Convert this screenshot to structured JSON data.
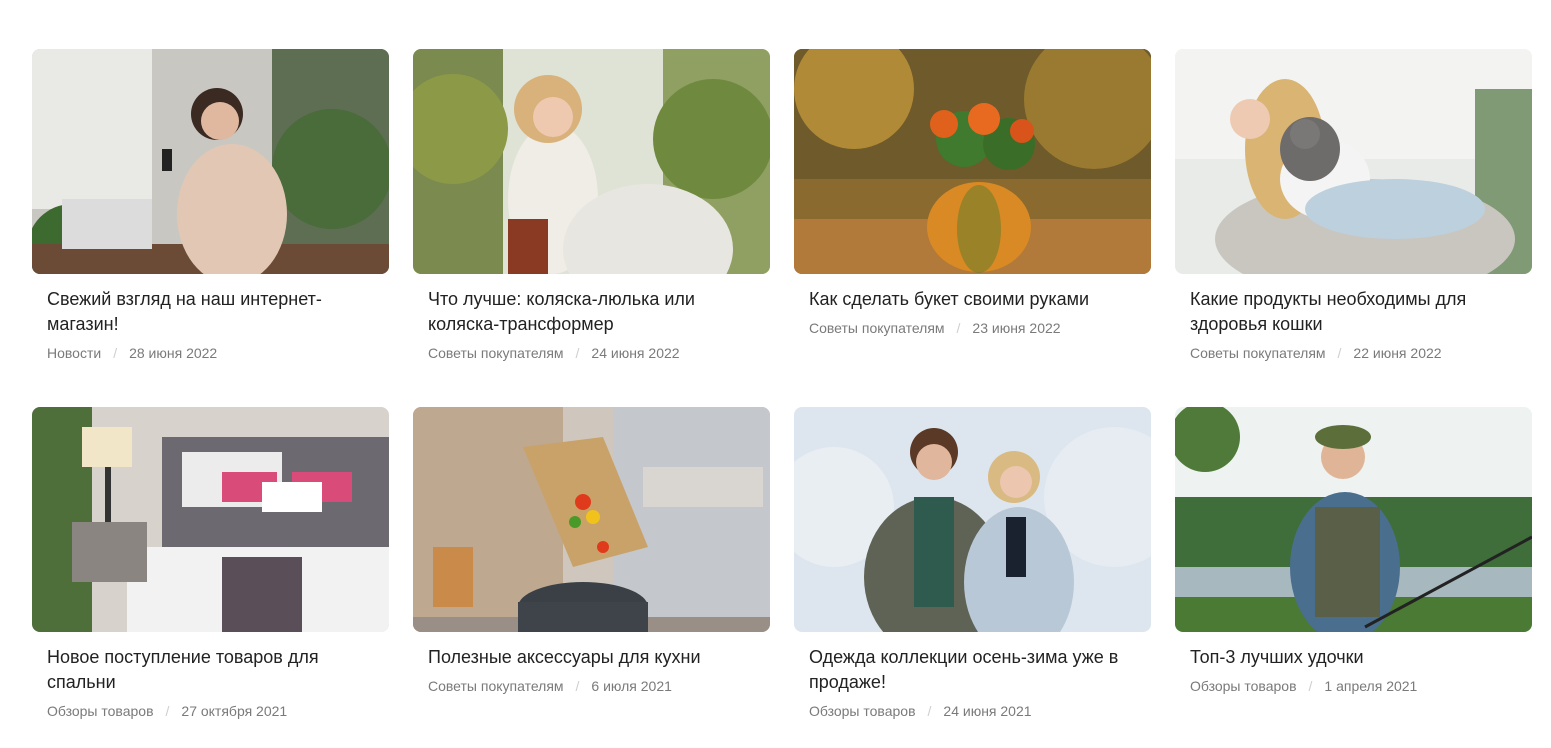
{
  "articles": [
    {
      "title": "Свежий взгляд на наш интернет-магазин!",
      "category": "Новости",
      "date": "28 июня 2022",
      "image": "woman-with-phone-photo"
    },
    {
      "title": "Что лучше: коляска-люлька или коляска-трансформер",
      "category": "Советы покупателям",
      "date": "24 июня 2022",
      "image": "woman-with-stroller-photo"
    },
    {
      "title": "Как сделать букет своими руками",
      "category": "Советы покупателям",
      "date": "23 июня 2022",
      "image": "pumpkin-bouquet-photo"
    },
    {
      "title": "Какие продукты необходимы для здоровья кошки",
      "category": "Советы покупателям",
      "date": "22 июня 2022",
      "image": "woman-with-cat-photo"
    },
    {
      "title": "Новое поступление товаров для спальни",
      "category": "Обзоры товаров",
      "date": "27 октября 2021",
      "image": "bedroom-photo"
    },
    {
      "title": "Полезные аксессуары для кухни",
      "category": "Советы покупателям",
      "date": "6 июля 2021",
      "image": "kitchen-cutting-board-photo"
    },
    {
      "title": "Одежда коллекции осень-зима уже в продаже!",
      "category": "Обзоры товаров",
      "date": "24 июня 2021",
      "image": "winter-couple-photo"
    },
    {
      "title": "Топ-3 лучших удочки",
      "category": "Обзоры товаров",
      "date": "1 апреля 2021",
      "image": "fisherman-photo"
    }
  ],
  "meta_separator": "/"
}
